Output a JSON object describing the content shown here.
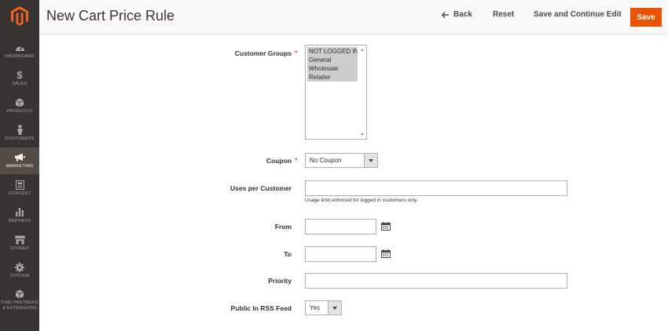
{
  "sidebar": {
    "items": [
      {
        "label": "DASHBOARD",
        "icon": "dashboard-icon"
      },
      {
        "label": "SALES",
        "icon": "dollar-icon"
      },
      {
        "label": "PRODUCTS",
        "icon": "cube-icon"
      },
      {
        "label": "CUSTOMERS",
        "icon": "person-icon"
      },
      {
        "label": "MARKETING",
        "icon": "megaphone-icon",
        "active": true
      },
      {
        "label": "CONTENT",
        "icon": "content-icon"
      },
      {
        "label": "REPORTS",
        "icon": "bar-chart-icon"
      },
      {
        "label": "STORES",
        "icon": "store-icon"
      },
      {
        "label": "SYSTEM",
        "icon": "gear-icon"
      },
      {
        "label": "FIND PARTNERS\n& EXTENSIONS",
        "icon": "box-icon"
      }
    ]
  },
  "header": {
    "title": "New Cart Price Rule",
    "back_label": "Back",
    "reset_label": "Reset",
    "save_continue_label": "Save and Continue Edit",
    "save_label": "Save"
  },
  "form": {
    "customer_groups": {
      "label": "Customer Groups",
      "required_mark": "*",
      "options": [
        "NOT LOGGED IN",
        "General",
        "Wholesale",
        "Retailer"
      ]
    },
    "coupon": {
      "label": "Coupon",
      "required_mark": "*",
      "value": "No Coupon"
    },
    "uses_per_customer": {
      "label": "Uses per Customer",
      "value": "",
      "note": "Usage limit enforced for logged in customers only."
    },
    "from": {
      "label": "From",
      "value": ""
    },
    "to": {
      "label": "To",
      "value": ""
    },
    "priority": {
      "label": "Priority",
      "value": ""
    },
    "rss": {
      "label": "Public In RSS Feed",
      "value": "Yes"
    }
  },
  "colors": {
    "accent": "#eb5202",
    "sidebar_bg": "#373330",
    "sidebar_active": "#524d49",
    "required": "#e22626"
  }
}
